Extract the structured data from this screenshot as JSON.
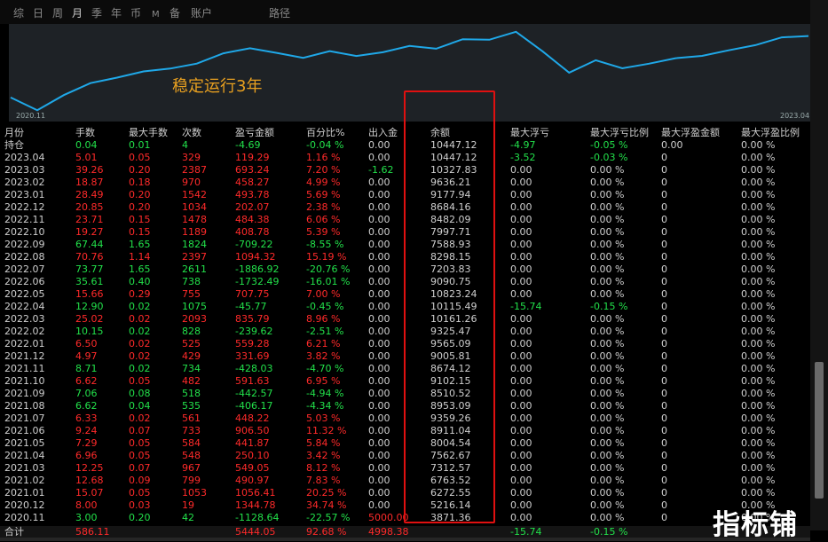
{
  "tabs": [
    {
      "label": "综",
      "active": false,
      "small": false
    },
    {
      "label": "日",
      "active": false,
      "small": false
    },
    {
      "label": "周",
      "active": false,
      "small": false
    },
    {
      "label": "月",
      "active": true,
      "small": false
    },
    {
      "label": "季",
      "active": false,
      "small": false
    },
    {
      "label": "年",
      "active": false,
      "small": false
    },
    {
      "label": "币",
      "active": false,
      "small": false
    },
    {
      "label": "M",
      "active": false,
      "small": true
    },
    {
      "label": "备",
      "active": false,
      "small": false
    },
    {
      "label": "账户",
      "active": false,
      "small": false
    },
    {
      "label": "路径",
      "active": false,
      "small": false
    }
  ],
  "chart": {
    "annotation": "稳定运行3年",
    "start_label": "2020.11",
    "end_label": "2023.04",
    "line_color": "#1fa8e8"
  },
  "table": {
    "headers": [
      "月份",
      "手数",
      "最大手数",
      "次数",
      "盈亏金额",
      "百分比%",
      "出入金",
      "余额",
      "最大浮亏",
      "最大浮亏比例",
      "最大浮盈金额",
      "最大浮盈比例"
    ],
    "rows": [
      {
        "cells": [
          "持仓",
          "0.04",
          "0.01",
          "4",
          "-4.69",
          "-0.04 %",
          "0.00",
          "10447.12",
          "-4.97",
          "-0.05 %",
          "0.00",
          "0.00 %"
        ],
        "tone": "g"
      },
      {
        "cells": [
          "2023.04",
          "5.01",
          "0.05",
          "329",
          "119.29",
          "1.16 %",
          "0.00",
          "10447.12",
          "-3.52",
          "-0.03 %",
          "0",
          "0.00 %"
        ],
        "tone": "r"
      },
      {
        "cells": [
          "2023.03",
          "39.26",
          "0.20",
          "2387",
          "693.24",
          "7.20 %",
          "-1.62",
          "10327.83",
          "0.00",
          "0.00 %",
          "0",
          "0.00 %"
        ],
        "tone": "r"
      },
      {
        "cells": [
          "2023.02",
          "18.87",
          "0.18",
          "970",
          "458.27",
          "4.99 %",
          "0.00",
          "9636.21",
          "0.00",
          "0.00 %",
          "0",
          "0.00 %"
        ],
        "tone": "r"
      },
      {
        "cells": [
          "2023.01",
          "28.49",
          "0.20",
          "1542",
          "493.78",
          "5.69 %",
          "0.00",
          "9177.94",
          "0.00",
          "0.00 %",
          "0",
          "0.00 %"
        ],
        "tone": "r"
      },
      {
        "cells": [
          "2022.12",
          "20.85",
          "0.20",
          "1034",
          "202.07",
          "2.38 %",
          "0.00",
          "8684.16",
          "0.00",
          "0.00 %",
          "0",
          "0.00 %"
        ],
        "tone": "r"
      },
      {
        "cells": [
          "2022.11",
          "23.71",
          "0.15",
          "1478",
          "484.38",
          "6.06 %",
          "0.00",
          "8482.09",
          "0.00",
          "0.00 %",
          "0",
          "0.00 %"
        ],
        "tone": "r"
      },
      {
        "cells": [
          "2022.10",
          "19.27",
          "0.15",
          "1189",
          "408.78",
          "5.39 %",
          "0.00",
          "7997.71",
          "0.00",
          "0.00 %",
          "0",
          "0.00 %"
        ],
        "tone": "r"
      },
      {
        "cells": [
          "2022.09",
          "67.44",
          "1.65",
          "1824",
          "-709.22",
          "-8.55 %",
          "0.00",
          "7588.93",
          "0.00",
          "0.00 %",
          "0",
          "0.00 %"
        ],
        "tone": "g"
      },
      {
        "cells": [
          "2022.08",
          "70.76",
          "1.14",
          "2397",
          "1094.32",
          "15.19 %",
          "0.00",
          "8298.15",
          "0.00",
          "0.00 %",
          "0",
          "0.00 %"
        ],
        "tone": "r"
      },
      {
        "cells": [
          "2022.07",
          "73.77",
          "1.65",
          "2611",
          "-1886.92",
          "-20.76 %",
          "0.00",
          "7203.83",
          "0.00",
          "0.00 %",
          "0",
          "0.00 %"
        ],
        "tone": "g"
      },
      {
        "cells": [
          "2022.06",
          "35.61",
          "0.40",
          "738",
          "-1732.49",
          "-16.01 %",
          "0.00",
          "9090.75",
          "0.00",
          "0.00 %",
          "0",
          "0.00 %"
        ],
        "tone": "g"
      },
      {
        "cells": [
          "2022.05",
          "15.66",
          "0.29",
          "755",
          "707.75",
          "7.00 %",
          "0.00",
          "10823.24",
          "0.00",
          "0.00 %",
          "0",
          "0.00 %"
        ],
        "tone": "r"
      },
      {
        "cells": [
          "2022.04",
          "12.90",
          "0.02",
          "1075",
          "-45.77",
          "-0.45 %",
          "0.00",
          "10115.49",
          "-15.74",
          "-0.15 %",
          "0",
          "0.00 %"
        ],
        "tone": "g"
      },
      {
        "cells": [
          "2022.03",
          "25.02",
          "0.02",
          "2093",
          "835.79",
          "8.96 %",
          "0.00",
          "10161.26",
          "0.00",
          "0.00 %",
          "0",
          "0.00 %"
        ],
        "tone": "r"
      },
      {
        "cells": [
          "2022.02",
          "10.15",
          "0.02",
          "828",
          "-239.62",
          "-2.51 %",
          "0.00",
          "9325.47",
          "0.00",
          "0.00 %",
          "0",
          "0.00 %"
        ],
        "tone": "g"
      },
      {
        "cells": [
          "2022.01",
          "6.50",
          "0.02",
          "525",
          "559.28",
          "6.21 %",
          "0.00",
          "9565.09",
          "0.00",
          "0.00 %",
          "0",
          "0.00 %"
        ],
        "tone": "r"
      },
      {
        "cells": [
          "2021.12",
          "4.97",
          "0.02",
          "429",
          "331.69",
          "3.82 %",
          "0.00",
          "9005.81",
          "0.00",
          "0.00 %",
          "0",
          "0.00 %"
        ],
        "tone": "r"
      },
      {
        "cells": [
          "2021.11",
          "8.71",
          "0.02",
          "734",
          "-428.03",
          "-4.70 %",
          "0.00",
          "8674.12",
          "0.00",
          "0.00 %",
          "0",
          "0.00 %"
        ],
        "tone": "g"
      },
      {
        "cells": [
          "2021.10",
          "6.62",
          "0.05",
          "482",
          "591.63",
          "6.95 %",
          "0.00",
          "9102.15",
          "0.00",
          "0.00 %",
          "0",
          "0.00 %"
        ],
        "tone": "r"
      },
      {
        "cells": [
          "2021.09",
          "7.06",
          "0.08",
          "518",
          "-442.57",
          "-4.94 %",
          "0.00",
          "8510.52",
          "0.00",
          "0.00 %",
          "0",
          "0.00 %"
        ],
        "tone": "g"
      },
      {
        "cells": [
          "2021.08",
          "6.62",
          "0.04",
          "535",
          "-406.17",
          "-4.34 %",
          "0.00",
          "8953.09",
          "0.00",
          "0.00 %",
          "0",
          "0.00 %"
        ],
        "tone": "g"
      },
      {
        "cells": [
          "2021.07",
          "6.33",
          "0.02",
          "561",
          "448.22",
          "5.03 %",
          "0.00",
          "9359.26",
          "0.00",
          "0.00 %",
          "0",
          "0.00 %"
        ],
        "tone": "r"
      },
      {
        "cells": [
          "2021.06",
          "9.24",
          "0.07",
          "733",
          "906.50",
          "11.32 %",
          "0.00",
          "8911.04",
          "0.00",
          "0.00 %",
          "0",
          "0.00 %"
        ],
        "tone": "r"
      },
      {
        "cells": [
          "2021.05",
          "7.29",
          "0.05",
          "584",
          "441.87",
          "5.84 %",
          "0.00",
          "8004.54",
          "0.00",
          "0.00 %",
          "0",
          "0.00 %"
        ],
        "tone": "r"
      },
      {
        "cells": [
          "2021.04",
          "6.96",
          "0.05",
          "548",
          "250.10",
          "3.42 %",
          "0.00",
          "7562.67",
          "0.00",
          "0.00 %",
          "0",
          "0.00 %"
        ],
        "tone": "r"
      },
      {
        "cells": [
          "2021.03",
          "12.25",
          "0.07",
          "967",
          "549.05",
          "8.12 %",
          "0.00",
          "7312.57",
          "0.00",
          "0.00 %",
          "0",
          "0.00 %"
        ],
        "tone": "r"
      },
      {
        "cells": [
          "2021.02",
          "12.68",
          "0.09",
          "799",
          "490.97",
          "7.83 %",
          "0.00",
          "6763.52",
          "0.00",
          "0.00 %",
          "0",
          "0.00 %"
        ],
        "tone": "r"
      },
      {
        "cells": [
          "2021.01",
          "15.07",
          "0.05",
          "1053",
          "1056.41",
          "20.25 %",
          "0.00",
          "6272.55",
          "0.00",
          "0.00 %",
          "0",
          "0.00 %"
        ],
        "tone": "r"
      },
      {
        "cells": [
          "2020.12",
          "8.00",
          "0.03",
          "19",
          "1344.78",
          "34.74 %",
          "0.00",
          "5216.14",
          "0.00",
          "0.00 %",
          "0",
          "0.00 %"
        ],
        "tone": "r"
      },
      {
        "cells": [
          "2020.11",
          "3.00",
          "0.20",
          "42",
          "-1128.64",
          "-22.57 %",
          "5000.00",
          "3871.36",
          "0.00",
          "0.00 %",
          "0",
          "0.00 %"
        ],
        "tone": "g"
      }
    ],
    "totals": {
      "label": "合计",
      "lots": "586.11",
      "profit": "5444.05",
      "percent": "92.68 %",
      "deposit": "4998.38",
      "max_float_loss": "-15.74",
      "max_float_loss_pct": "-0.15 %"
    }
  },
  "watermark": "指标铺"
}
